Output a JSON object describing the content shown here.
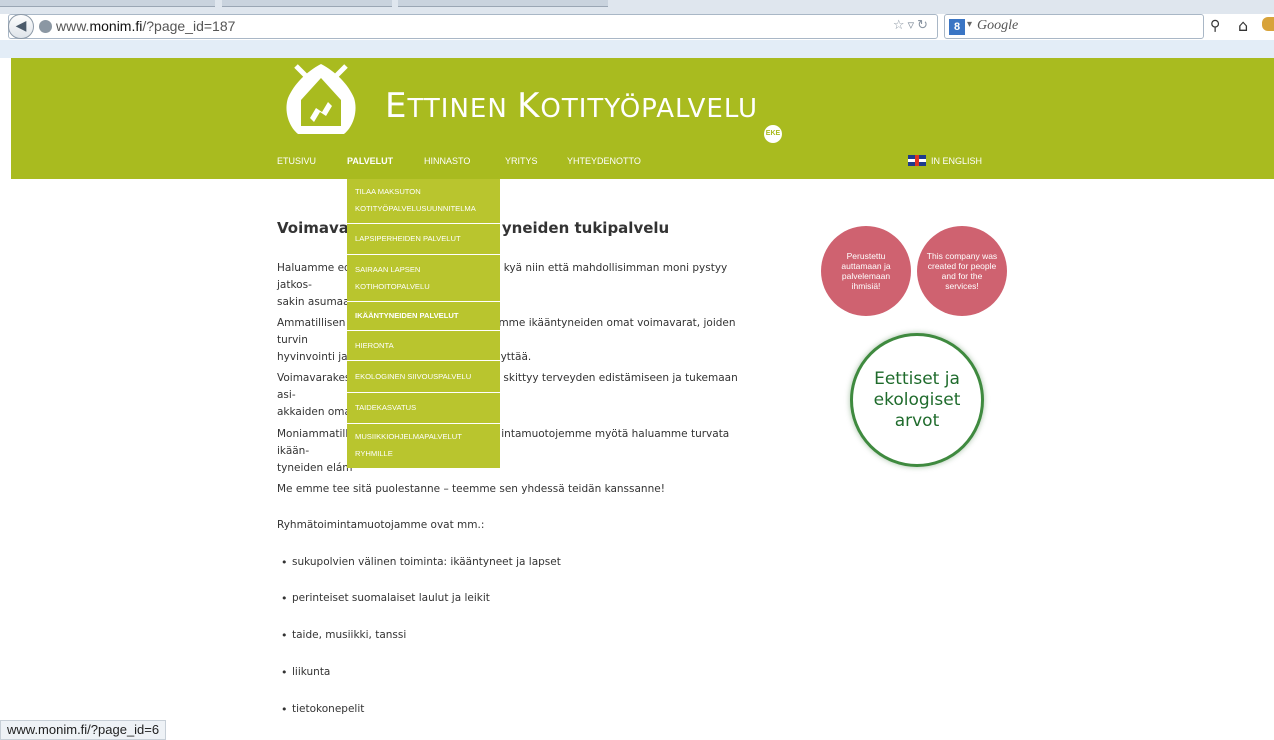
{
  "browser": {
    "url_prefix": "www.",
    "url_domain": "monim.fi",
    "url_path": "/?page_id=187",
    "search_placeholder": "Google",
    "search_engine_icon": "google-icon",
    "status_url": "www.monim.fi/?page_id=6"
  },
  "header": {
    "title_first": "E",
    "title_first_rest": "ttinen ",
    "title_second": "K",
    "title_second_rest": "otityöpalvelu",
    "badge": "EKE",
    "colors": {
      "header_bg": "#a9bb1f",
      "dropdown_bg": "#b9c52e"
    }
  },
  "nav": {
    "items": [
      {
        "label": "Etusivu"
      },
      {
        "label": "Palvelut"
      },
      {
        "label": "Hinnasto"
      },
      {
        "label": "Yritys"
      },
      {
        "label": "Yhteydenotto"
      }
    ],
    "english_label": "In English"
  },
  "dropdown": {
    "items": [
      {
        "line1": "Tilaa maksuton",
        "line2": "kotityöpalvelusuunnitelma"
      },
      {
        "line1": "Lapsiperheiden palvelut",
        "line2": ""
      },
      {
        "line1": "Sairaan lapsen",
        "line2": "kotihoitopalvelu"
      },
      {
        "line1": "Ikääntyneiden palvelut",
        "line2": ""
      },
      {
        "line1": "Hieronta",
        "line2": ""
      },
      {
        "line1": "Ekologinen siivouspalvelu",
        "line2": ""
      },
      {
        "line1": "Taidekasvatus",
        "line2": ""
      },
      {
        "line1": "Musiikkiohjelmapalvelut",
        "line2": "ryhmille"
      }
    ]
  },
  "content": {
    "title_left": "Voimava",
    "title_right": "yneiden tukipalvelu",
    "p1_left_l1": "Haluamme ed",
    "p1_right_l1": "kyä niin että mahdollisimman moni pystyy jatkos-",
    "p1_left_l2": "sakin asumaa",
    "p2_left_l1": "Ammatillisen",
    "p2_right_l1": "mme ikääntyneiden omat voimavarat, joiden turvin",
    "p2_left_l2": "hyvinvointi ja",
    "p2_right_l2": "yttää.",
    "p3_left_l1": "Voimavarakes",
    "p3_right_l1": "skittyy terveyden edistämiseen ja tukemaan asi-",
    "p3_left_l2": "akkaiden oma",
    "p4_left_l1": "Moniammatill",
    "p4_right_l1": "intamuotojemme myötä haluamme turvata ikään-",
    "p4_left_l2": "tyneiden elám",
    "p5": "Me emme tee sitä puolestanne – teemme sen yhdessä teidän kanssanne!",
    "p6": "Ryhmätoimintamuotojamme ovat mm.:",
    "bullets": [
      "sukupolvien välinen toiminta: ikääntyneet ja lapset",
      "perinteiset suomalaiset laulut ja leikit",
      "taide, musiikki, tanssi",
      "liikunta",
      "tietokonepelit"
    ]
  },
  "sidebar": {
    "circle_fi": "Perustettu auttamaan ja palvelemaan ihmisiä!",
    "circle_en": "This company was created for people and for the services!",
    "big_circle": "Eettiset ja ekologiset arvot"
  }
}
